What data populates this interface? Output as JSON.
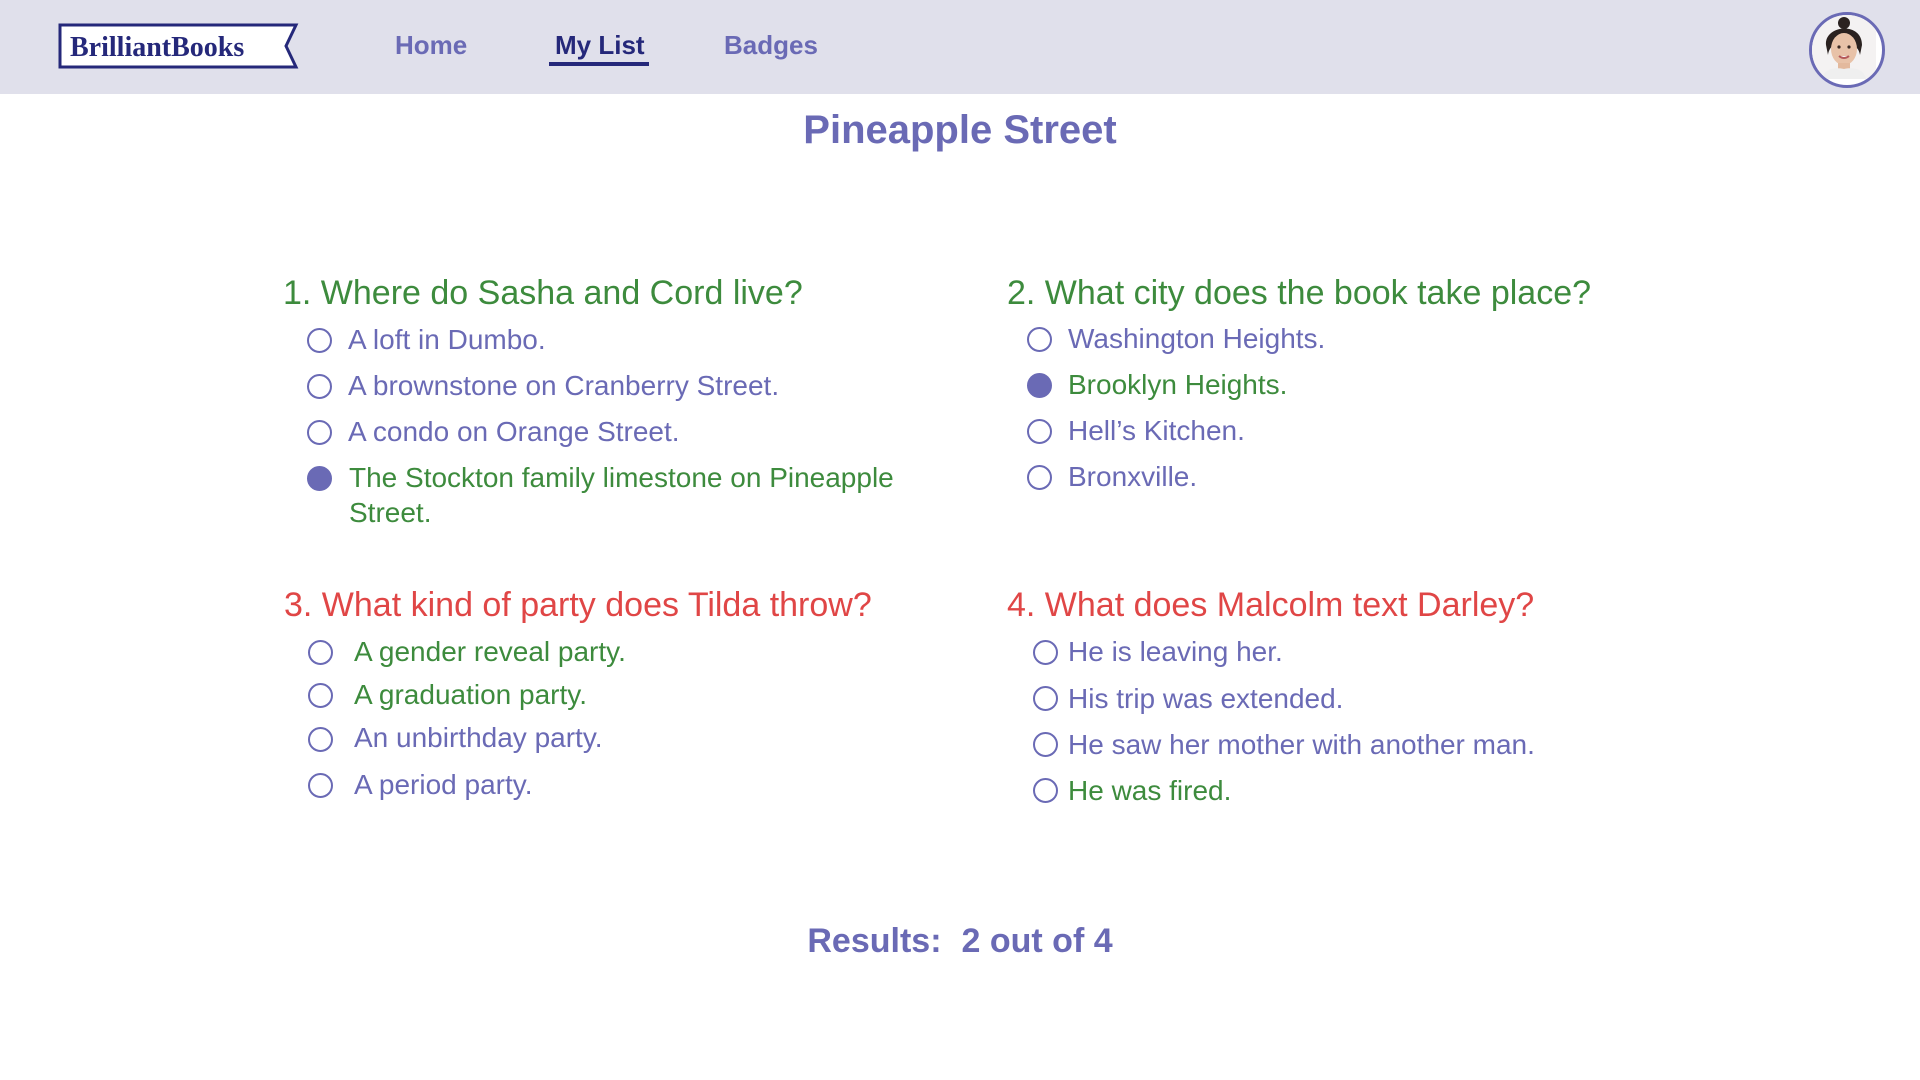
{
  "header": {
    "logo_text": "BrilliantBooks",
    "nav": [
      "Home",
      "My List",
      "Badges"
    ],
    "active_nav": "My List"
  },
  "page": {
    "title": "Pineapple Street"
  },
  "questions": [
    {
      "text": "1. Where do Sasha and Cord live?",
      "status": "correct",
      "options": [
        "A loft in Dumbo.",
        "A brownstone on Cranberry Street.",
        "A condo on Orange Street.",
        "The Stockton family limestone on Pineapple Street."
      ],
      "selected_index": 3,
      "correct_index": 3
    },
    {
      "text": "2. What city does the book take place?",
      "status": "correct",
      "options": [
        "Washington Heights.",
        "Brooklyn Heights.",
        "Hell’s Kitchen.",
        "Bronxville."
      ],
      "selected_index": 1,
      "correct_index": 1
    },
    {
      "text": "3. What kind of party does Tilda throw?",
      "status": "incorrect",
      "options": [
        "A gender reveal party.",
        "A graduation party.",
        "An unbirthday party.",
        "A period party."
      ],
      "selected_index": null,
      "correct_index": 0
    },
    {
      "text": "4. What does Malcolm text Darley?",
      "status": "incorrect",
      "options": [
        "He is leaving her.",
        "His trip was extended.",
        "He saw her mother with another man.",
        "He was fired."
      ],
      "selected_index": null,
      "correct_index": 3
    }
  ],
  "results": {
    "label": "Results:",
    "value": "2 out of 4"
  },
  "colors": {
    "nav_bg": "#e0e0eb",
    "accent": "#6a6ab5",
    "nav_active": "#25287a",
    "correct": "#3d8b3d",
    "incorrect": "#e04646"
  }
}
